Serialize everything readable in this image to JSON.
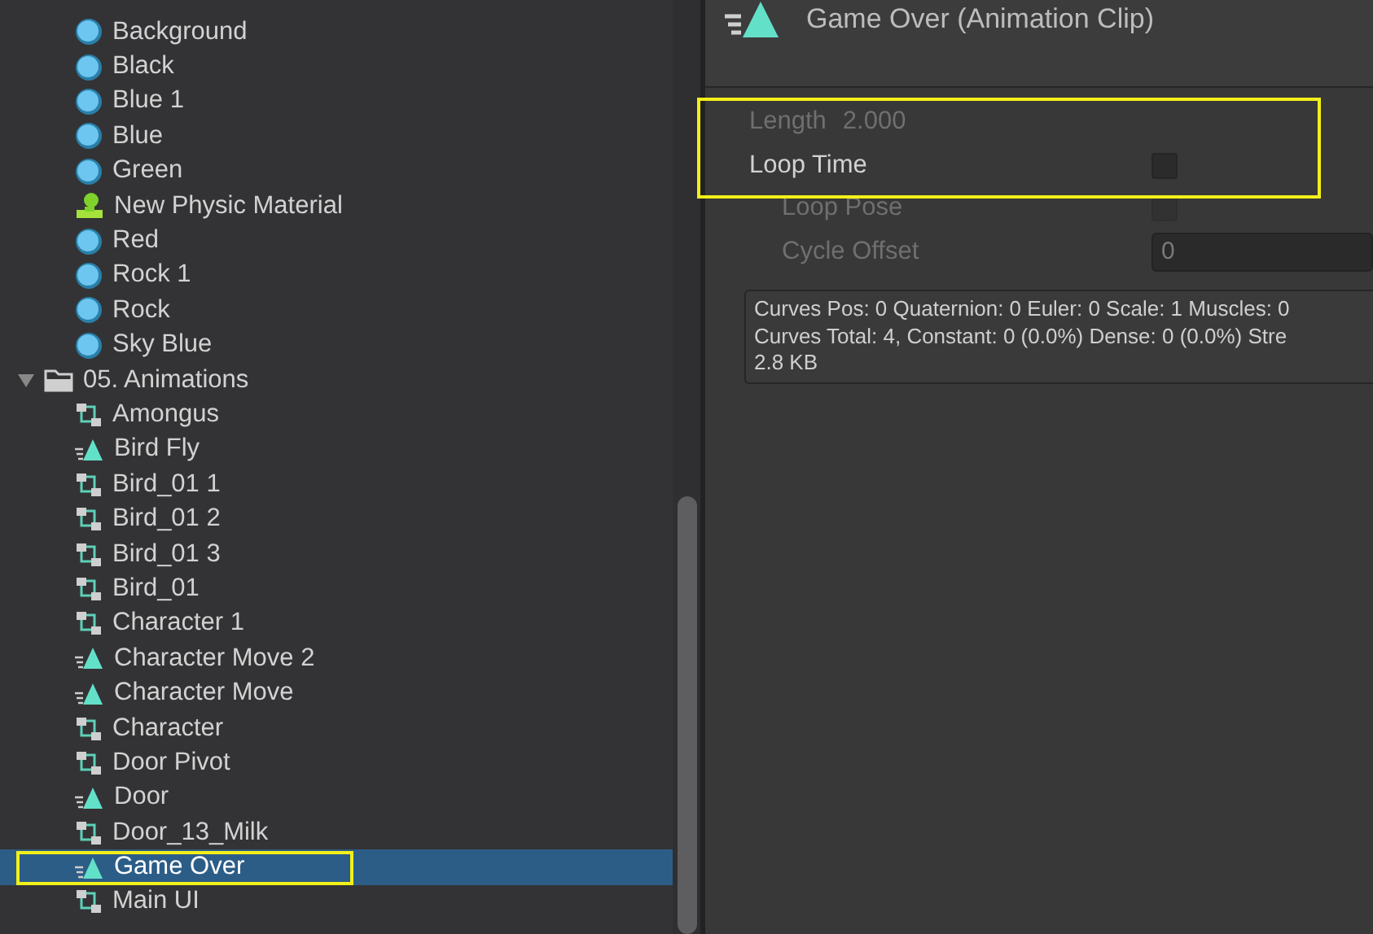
{
  "project_tree": {
    "items": [
      {
        "kind": "material",
        "label": "Background",
        "selected": false
      },
      {
        "kind": "material",
        "label": "Black",
        "selected": false
      },
      {
        "kind": "material",
        "label": "Blue 1",
        "selected": false
      },
      {
        "kind": "material",
        "label": "Blue",
        "selected": false
      },
      {
        "kind": "material",
        "label": "Green",
        "selected": false
      },
      {
        "kind": "physic-material",
        "label": "New Physic Material",
        "selected": false
      },
      {
        "kind": "material",
        "label": "Red",
        "selected": false
      },
      {
        "kind": "material",
        "label": "Rock 1",
        "selected": false
      },
      {
        "kind": "material",
        "label": "Rock",
        "selected": false
      },
      {
        "kind": "material",
        "label": "Sky Blue",
        "selected": false
      },
      {
        "kind": "folder",
        "label": "05. Animations",
        "expanded": true,
        "selected": false,
        "children": [
          {
            "kind": "controller",
            "label": "Amongus",
            "selected": false
          },
          {
            "kind": "clip",
            "label": "Bird Fly",
            "selected": false
          },
          {
            "kind": "controller",
            "label": "Bird_01 1",
            "selected": false
          },
          {
            "kind": "controller",
            "label": "Bird_01 2",
            "selected": false
          },
          {
            "kind": "controller",
            "label": "Bird_01 3",
            "selected": false
          },
          {
            "kind": "controller",
            "label": "Bird_01",
            "selected": false
          },
          {
            "kind": "controller",
            "label": "Character 1",
            "selected": false
          },
          {
            "kind": "clip",
            "label": "Character Move 2",
            "selected": false
          },
          {
            "kind": "clip",
            "label": "Character Move",
            "selected": false
          },
          {
            "kind": "controller",
            "label": "Character",
            "selected": false
          },
          {
            "kind": "controller",
            "label": "Door Pivot",
            "selected": false
          },
          {
            "kind": "clip",
            "label": "Door",
            "selected": false
          },
          {
            "kind": "controller",
            "label": "Door_13_Milk",
            "selected": false
          },
          {
            "kind": "clip",
            "label": "Game Over",
            "selected": true
          },
          {
            "kind": "controller",
            "label": "Main UI",
            "selected": false
          }
        ]
      }
    ]
  },
  "inspector": {
    "title": "Game Over (Animation Clip)",
    "fields": [
      {
        "kind": "readout",
        "label": "Length",
        "value": "2.000",
        "disabled": true
      },
      {
        "kind": "checkbox",
        "label": "Loop Time",
        "checked": false,
        "disabled": false
      },
      {
        "kind": "checkbox",
        "label": "Loop Pose",
        "checked": false,
        "disabled": true
      },
      {
        "kind": "number",
        "label": "Cycle Offset",
        "value": "0",
        "disabled": true
      }
    ],
    "info_lines": [
      "Curves Pos: 0 Quaternion: 0 Euler: 0 Scale: 1 Muscles: 0",
      "Curves Total: 4, Constant: 0 (0.0%) Dense: 0 (0.0%) Stre",
      "2.8 KB"
    ]
  }
}
